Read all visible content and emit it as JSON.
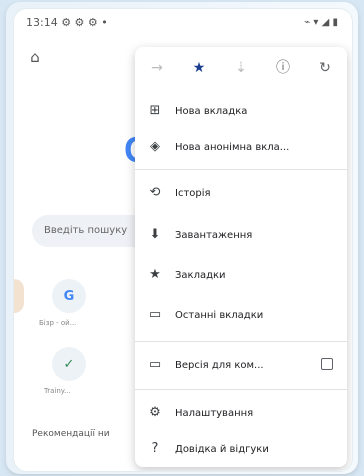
{
  "status": {
    "time": "13:14 ⚙ ⚙ ⚙ •",
    "signal": "⌁ ▾ ◢ ▮"
  },
  "page": {
    "search_placeholder": "Введіть пошуку",
    "tiles": [
      {
        "glyph": "G",
        "label": "Бізр - ой..."
      },
      {
        "glyph": "✓",
        "label": "Trainy..."
      }
    ],
    "recommendations": "Рекомендації ни"
  },
  "menu": {
    "top_icons": [
      "forward-icon",
      "star-icon",
      "download-icon",
      "info-icon",
      "refresh-icon"
    ],
    "items": [
      {
        "icon": "new-tab-icon",
        "glyph": "⊞",
        "label": "Нова вкладка"
      },
      {
        "icon": "incognito-icon",
        "glyph": "◈",
        "label": "Нова анонімна вкла..."
      },
      {
        "icon": "history-icon",
        "glyph": "⟲",
        "label": "Історія"
      },
      {
        "icon": "downloads-icon",
        "glyph": "⬇",
        "label": "Завантаження"
      },
      {
        "icon": "bookmarks-icon",
        "glyph": "★",
        "label": "Закладки"
      },
      {
        "icon": "recent-tabs-icon",
        "glyph": "▭",
        "label": "Останні вкладки"
      },
      {
        "icon": "desktop-site-icon",
        "glyph": "▭",
        "label": "Версія для ком..."
      },
      {
        "icon": "settings-icon",
        "glyph": "⚙",
        "label": "Налаштування"
      },
      {
        "icon": "help-icon",
        "glyph": "?",
        "label": "Довідка й відгуки"
      }
    ]
  }
}
